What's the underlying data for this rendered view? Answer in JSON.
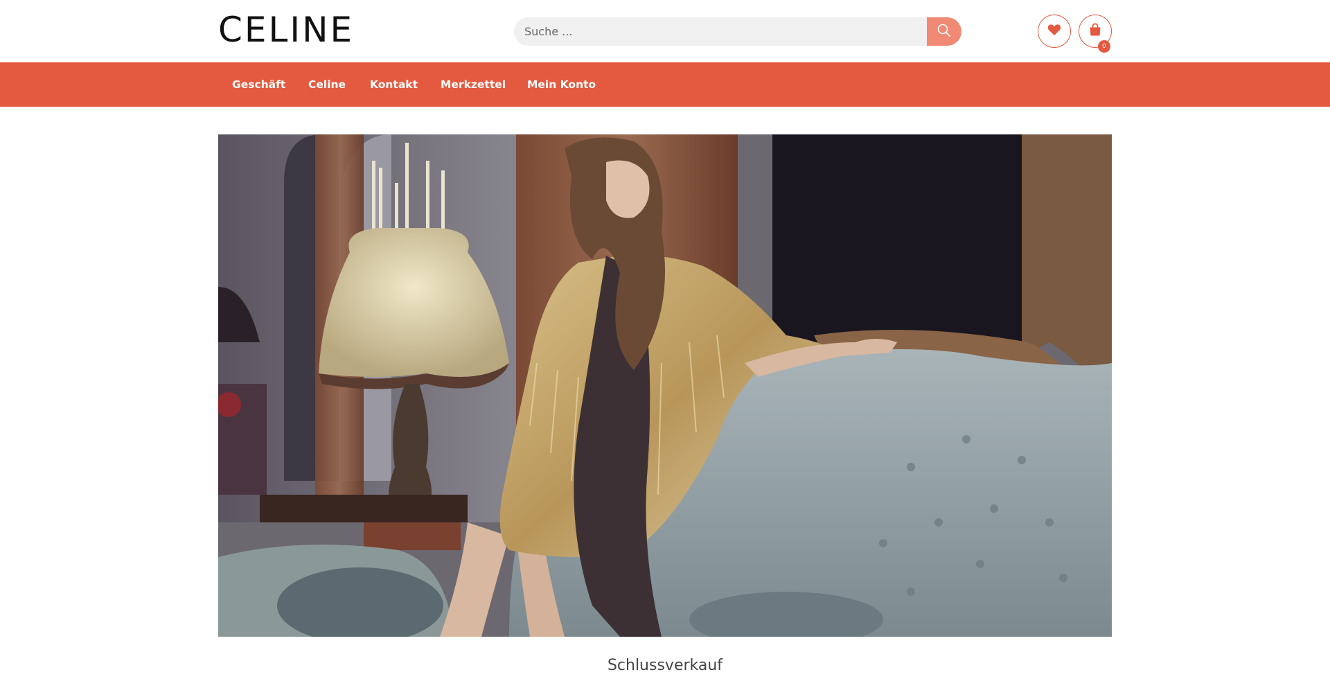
{
  "brand": {
    "logo": "CELINE"
  },
  "search": {
    "placeholder": "Suche ..."
  },
  "header": {
    "cart_count": "0"
  },
  "nav": {
    "items": [
      {
        "label": "Geschäft"
      },
      {
        "label": "Celine"
      },
      {
        "label": "Kontakt"
      },
      {
        "label": "Merkzettel"
      },
      {
        "label": "Mein Konto"
      }
    ]
  },
  "hero": {
    "caption": "Schlussverkauf"
  },
  "icons": {
    "search": "search-icon",
    "wishlist": "heart-icon",
    "cart": "shopping-bag-icon"
  },
  "colors": {
    "accent": "#e45a40",
    "search_button": "#f08a74",
    "search_field": "#f0f0f0"
  }
}
